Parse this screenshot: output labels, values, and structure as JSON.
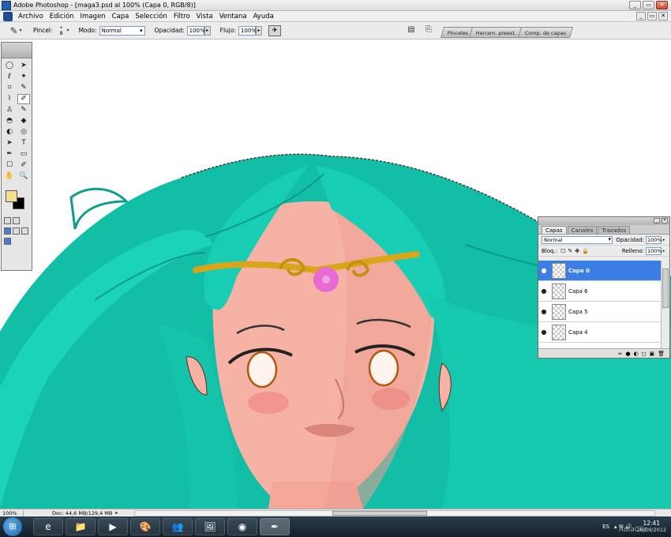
{
  "window": {
    "title": "Adobe Photoshop - [maga3.psd al 100% (Capa 0, RGB/8)]",
    "controls": [
      "_",
      "▭",
      "✕"
    ],
    "doc_controls": [
      "_",
      "▭",
      "✕"
    ]
  },
  "menu": [
    "Archivo",
    "Edición",
    "Imagen",
    "Capa",
    "Selección",
    "Filtro",
    "Vista",
    "Ventana",
    "Ayuda"
  ],
  "options": {
    "brush_label": "Pincel:",
    "brush_size": "8",
    "mode_label": "Modo:",
    "mode_value": "Normal",
    "opacity_label": "Opacidad:",
    "opacity_value": "100%",
    "flow_label": "Flujo:",
    "flow_value": "100%"
  },
  "palette_wells": [
    "Pinceles",
    "Herram. preest.",
    "Comp. de capas"
  ],
  "toolbox": {
    "tools": [
      "◯",
      "➤",
      "ℓ",
      "✦",
      "⌗",
      "✎",
      "⌇",
      "✐",
      "♙",
      "✎",
      "◓",
      "◆",
      "◐",
      "◎",
      "➤",
      "T",
      "✒",
      "▭",
      "☐",
      "✐",
      "✋",
      "🔍"
    ],
    "foreground_color": "#f3e08e",
    "background_color": "#000000"
  },
  "layers_panel": {
    "tabs": [
      "Capas",
      "Canales",
      "Trazados"
    ],
    "blend_mode": "Normal",
    "opacity_label": "Opacidad:",
    "opacity_value": "100%",
    "lock_label": "Bloq.:",
    "fill_label": "Relleno:",
    "fill_value": "100%",
    "layers": [
      {
        "name": "Capa 0",
        "selected": true
      },
      {
        "name": "Capa 6",
        "selected": false
      },
      {
        "name": "Capa 5",
        "selected": false
      },
      {
        "name": "Capa 4",
        "selected": false
      }
    ],
    "footer_icons": [
      "∞",
      "●",
      "◐",
      "◻",
      "▣",
      "🗑"
    ]
  },
  "status": {
    "zoom": "100%",
    "doc_info": "Doc: 44,6 MB/129,4 MB"
  },
  "taskbar": {
    "apps": [
      "e",
      "📁",
      "▶",
      "🎨",
      "👥",
      "🖼",
      "◉",
      "✒"
    ],
    "language": "ES",
    "time": "12:41",
    "date": "26/09/2012",
    "watermark": "AulaClic"
  },
  "colors": {
    "hair": "#16c9b0",
    "skin": "#f6b3a5",
    "selection_blue": "#3b7ee6"
  }
}
